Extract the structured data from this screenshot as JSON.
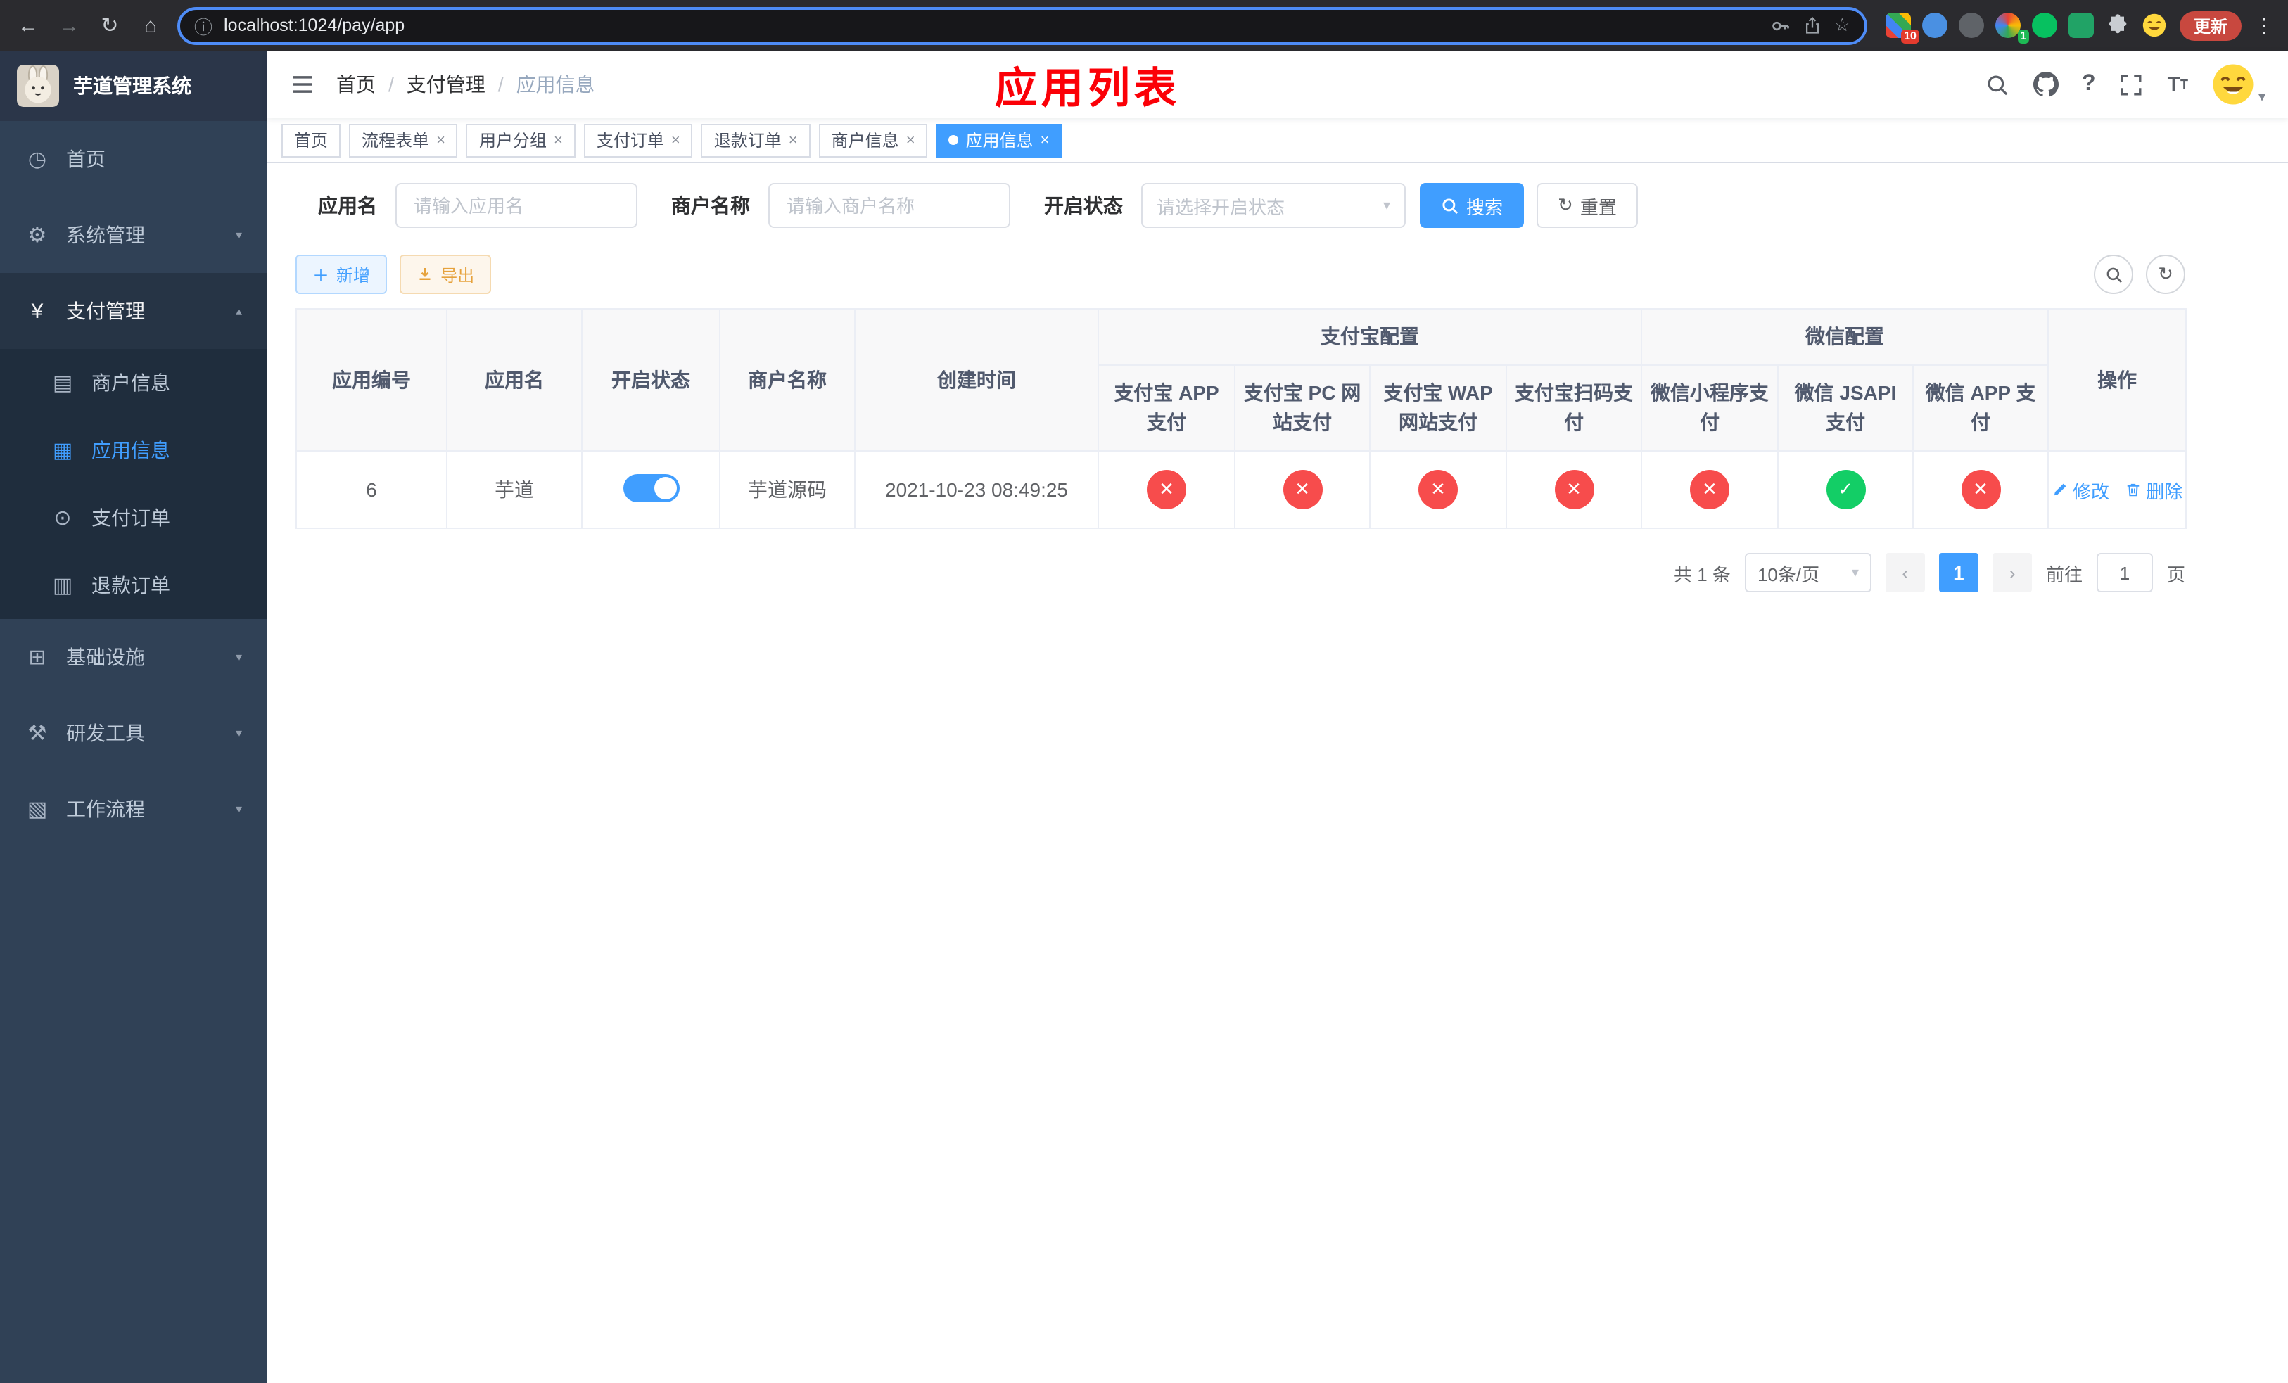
{
  "browser": {
    "url": "localhost:1024/pay/app",
    "update_label": "更新",
    "ext_badge_1": "10",
    "ext_badge_2": "1"
  },
  "sidebar": {
    "title": "芋道管理系统",
    "items": [
      {
        "label": "首页",
        "icon": "dashboard-icon"
      },
      {
        "label": "系统管理",
        "icon": "gear-icon"
      },
      {
        "label": "支付管理",
        "icon": "yen-icon"
      },
      {
        "label": "商户信息",
        "icon": "merchant-card-icon"
      },
      {
        "label": "应用信息",
        "icon": "app-grid-icon"
      },
      {
        "label": "支付订单",
        "icon": "pay-order-icon"
      },
      {
        "label": "退款订单",
        "icon": "refund-order-icon"
      },
      {
        "label": "基础设施",
        "icon": "infrastructure-icon"
      },
      {
        "label": "研发工具",
        "icon": "devtools-icon"
      },
      {
        "label": "工作流程",
        "icon": "workflow-icon"
      }
    ]
  },
  "header": {
    "breadcrumbs": [
      "首页",
      "支付管理",
      "应用信息"
    ],
    "overlay_title": "应用列表"
  },
  "tabs": [
    {
      "label": "首页",
      "closable": false,
      "active": false
    },
    {
      "label": "流程表单",
      "closable": true,
      "active": false
    },
    {
      "label": "用户分组",
      "closable": true,
      "active": false
    },
    {
      "label": "支付订单",
      "closable": true,
      "active": false
    },
    {
      "label": "退款订单",
      "closable": true,
      "active": false
    },
    {
      "label": "商户信息",
      "closable": true,
      "active": false
    },
    {
      "label": "应用信息",
      "closable": true,
      "active": true
    }
  ],
  "filters": {
    "app_name_label": "应用名",
    "app_name_placeholder": "请输入应用名",
    "merchant_label": "商户名称",
    "merchant_placeholder": "请输入商户名称",
    "status_label": "开启状态",
    "status_placeholder": "请选择开启状态",
    "search_label": "搜索",
    "reset_label": "重置"
  },
  "toolbar": {
    "add_label": "新增",
    "export_label": "导出"
  },
  "table": {
    "groups": {
      "alipay": "支付宝配置",
      "wechat": "微信配置"
    },
    "columns": [
      "应用编号",
      "应用名",
      "开启状态",
      "商户名称",
      "创建时间",
      "支付宝 APP 支付",
      "支付宝 PC 网站支付",
      "支付宝 WAP 网站支付",
      "支付宝扫码支付",
      "微信小程序支付",
      "微信 JSAPI 支付",
      "微信 APP 支付",
      "操作"
    ],
    "row": {
      "id": "6",
      "name": "芋道",
      "enabled": true,
      "merchant": "芋道源码",
      "created": "2021-10-23 08:49:25",
      "configs": [
        false,
        false,
        false,
        false,
        false,
        true,
        false
      ],
      "edit_label": "修改",
      "delete_label": "删除"
    }
  },
  "pagination": {
    "total": "共 1 条",
    "page_size": "10条/页",
    "page": "1",
    "goto_prefix": "前往",
    "goto_value": "1",
    "goto_suffix": "页"
  },
  "icons": {
    "check": "✓",
    "cross": "✕"
  },
  "colors": {
    "accent": "#409eff",
    "danger": "#f74c4c",
    "success": "#13ce66",
    "warning": "#e6a23c",
    "annotation": "#fb0007",
    "sidebar": "#304156",
    "submenu": "#1f2d3d"
  }
}
